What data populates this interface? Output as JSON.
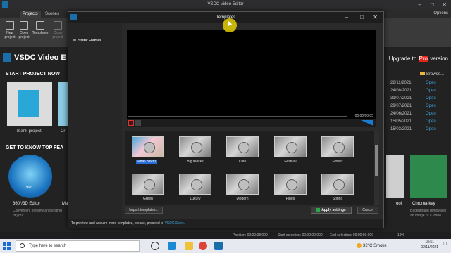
{
  "app": {
    "title": "VSDC Video Editor",
    "tabs": [
      "Projects",
      "Scenes"
    ],
    "options_label": "Options",
    "ribbon_buttons": [
      "New project",
      "Open project",
      "Templates",
      "Close project"
    ],
    "brand": "VSDC Video E",
    "upgrade": {
      "prefix": "Upgrade to ",
      "pro": "Pro",
      "suffix": " version"
    },
    "start_project_title": "START PROJECT NOW",
    "blank_project_label": "Blank project",
    "cr_label": "Cr",
    "get_to_know_title": "GET TO KNOW TOP FEA",
    "sphere_badge": "360°",
    "editor_360_label": "360°/3D Editor",
    "editor_360_desc": "Convenient preview and editing of your",
    "ma_label": "Ma",
    "tool_label": "ool",
    "chroma_label": "Chroma-key",
    "chroma_desc": "Background removal in an image or a video",
    "browse_label": "Browse...",
    "recent_dates": [
      "22/11/2021",
      "24/08/2021",
      "31/07/2021",
      "29/07/2021",
      "24/06/2021",
      "15/05/2021",
      "15/03/2021"
    ],
    "open_label": "Open"
  },
  "statusbar": {
    "position": "Position: 00:00:08.000",
    "start_selection": "Start selection: 00:00:00.000",
    "end_selection": "End selection: 00:00:00.000",
    "zoom": "19%"
  },
  "dialog": {
    "title": "Templates",
    "category": "Static Frames",
    "time_readout": "00:00/00:05",
    "templates": [
      {
        "name": "Small blocks",
        "selected": true
      },
      {
        "name": "Big Blocks"
      },
      {
        "name": "Cute"
      },
      {
        "name": "Festival"
      },
      {
        "name": "Flower"
      },
      {
        "name": "Green"
      },
      {
        "name": "Luxury"
      },
      {
        "name": "Modern"
      },
      {
        "name": "Pines"
      },
      {
        "name": "Spring"
      }
    ],
    "import_label": "Import templates...",
    "apply_label": "Apply settings",
    "cancel_label": "Cancel",
    "footer_text": "To preview and acquire more templates, please, proceed to ",
    "footer_link": "VSDC Store."
  },
  "taskbar": {
    "search_placeholder": "Type here to search",
    "weather": "32°C  Smoke",
    "time": "18:51",
    "date": "02/11/2021"
  },
  "colors": {
    "accent": "#1a6fa8",
    "selection": "#2b6fd6",
    "pro_badge": "#e0231b",
    "link": "#3aa3d8"
  }
}
